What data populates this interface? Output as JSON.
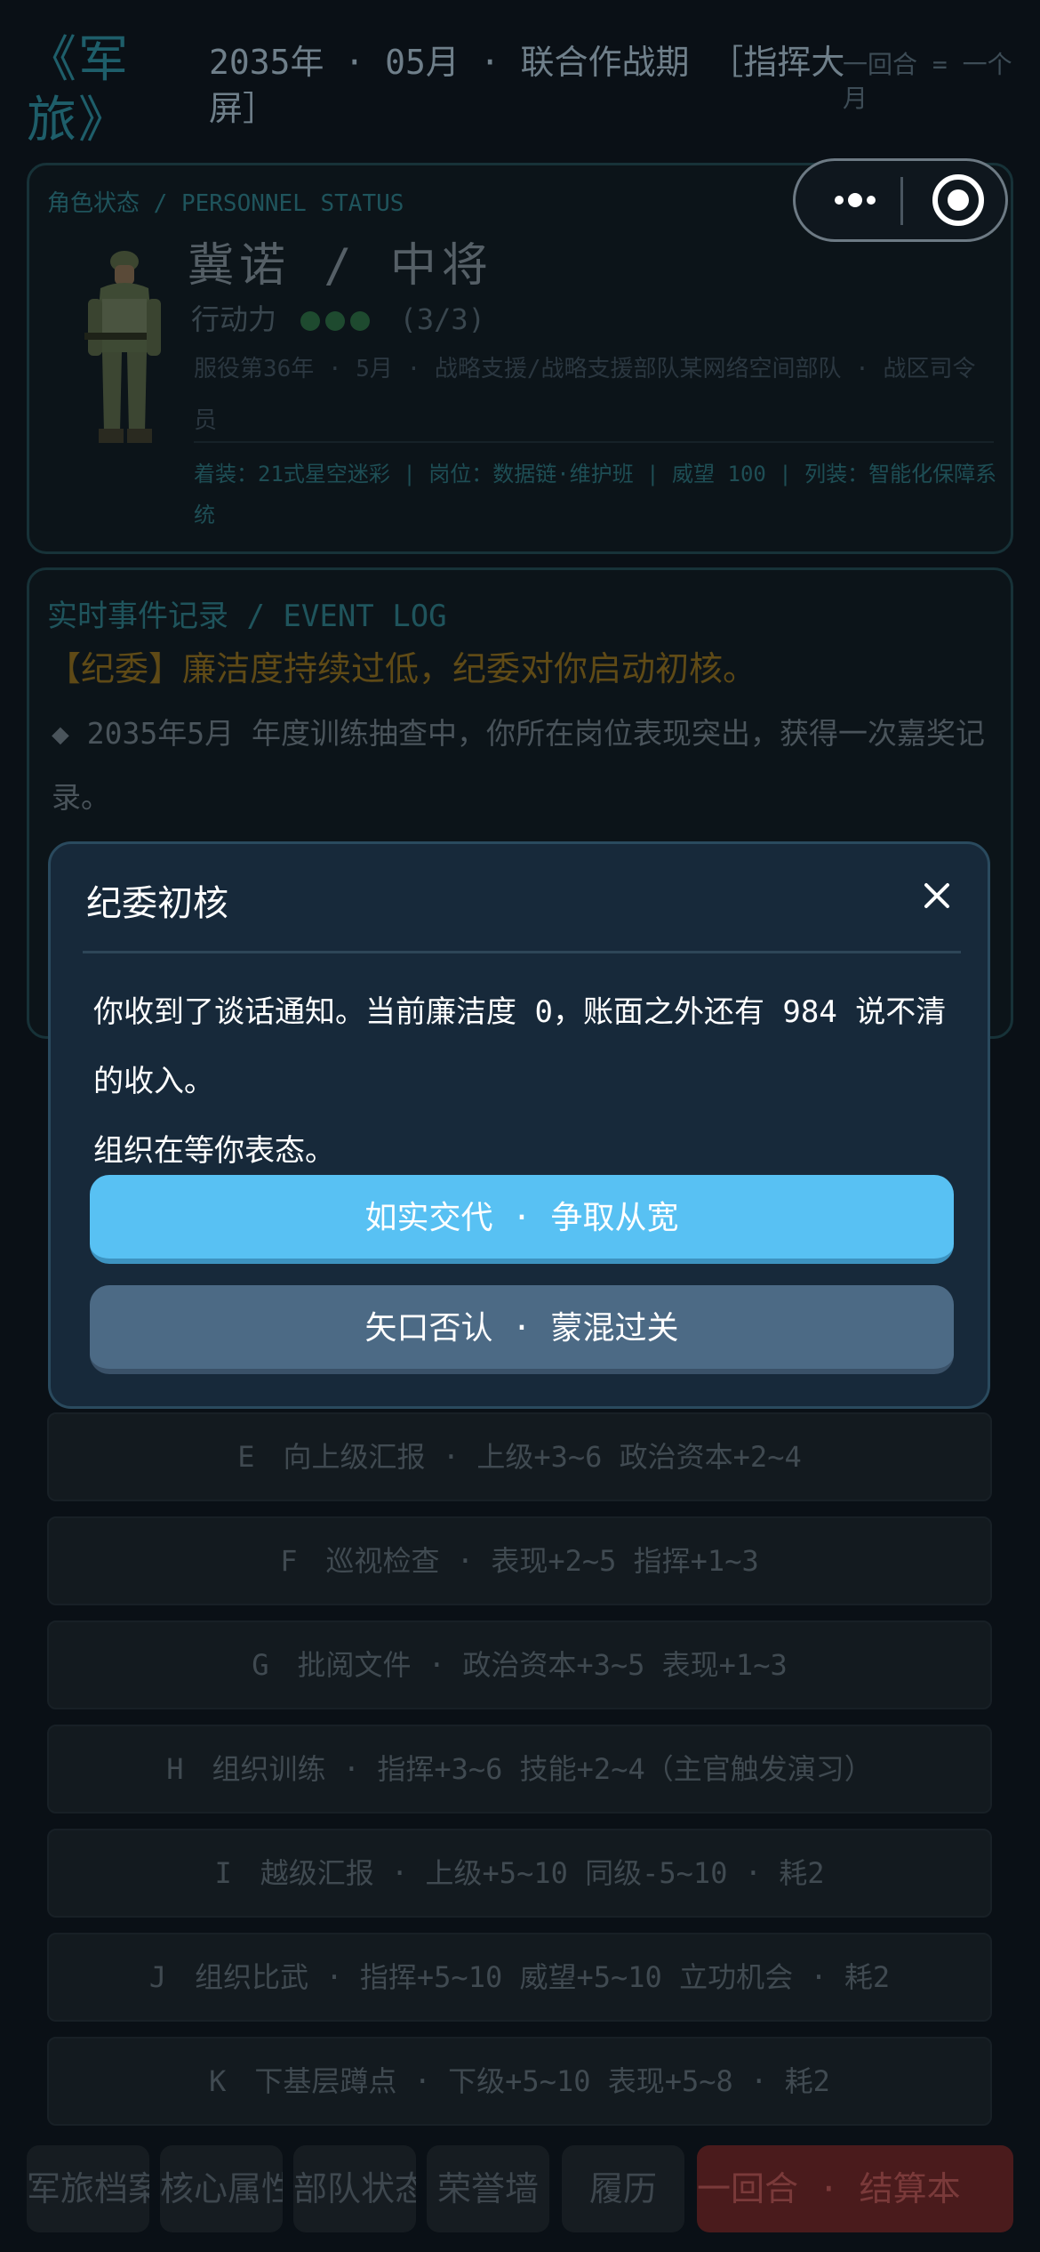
{
  "header": {
    "title": "《军旅》",
    "date_line": "2035年 · 05月 · 联合作战期 ［指挥大屏］",
    "turn_note": "一回合 = 一个月"
  },
  "status_panel": {
    "label": "角色状态 / PERSONNEL STATUS",
    "name_rank": "冀诺 / 中将",
    "action_points_label": "行动力",
    "action_points_dots": 3,
    "action_points_text": "(3/3)",
    "service_line": "服役第36年 · 5月 · 战略支援/战略支援部队某网络空间部队 · 战区司令员",
    "gear_line": "着装：21式星空迷彩 | 岗位：数据链·维护班 | 威望 100 | 列装：智能化保障系统"
  },
  "event_panel": {
    "label": "实时事件记录 / EVENT LOG",
    "alert": "【纪委】廉洁度持续过低，纪委对你启动初核。",
    "entry": "◆ 2035年5月 年度训练抽查中，你所在岗位表现突出，获得一次嘉奖记录。"
  },
  "actions": [
    "E　向上级汇报 · 上级+3~6 政治资本+2~4",
    "F　巡视检查 · 表现+2~5 指挥+1~3",
    "G　批阅文件 · 政治资本+3~5 表现+1~3",
    "H　组织训练 · 指挥+3~6 技能+2~4（主官触发演习）",
    "I　越级汇报 · 上级+5~10 同级-5~10 · 耗2",
    "J　组织比武 · 指挥+5~10 威望+5~10 立功机会 · 耗2",
    "K　下基层蹲点 · 下级+5~10 表现+5~8 · 耗2"
  ],
  "tabs": [
    "军旅档案",
    "核心属性",
    "部队状态",
    "荣誉墙",
    "履历"
  ],
  "end_turn": "一回合 · 结算本",
  "modal": {
    "title": "纪委初核",
    "body_line1": "你收到了谈话通知。当前廉洁度 0，账面之外还有 984 说不清的收入。",
    "body_line2": "组织在等你表态。",
    "primary_button": "如实交代 · 争取从宽",
    "secondary_button": "矢口否认 · 蒙混过关"
  },
  "icons": {
    "close": "close-icon",
    "more": "more-dots-icon",
    "target": "target-icon",
    "soldier": "soldier-avatar"
  },
  "colors": {
    "primary_button": "#58c1f3",
    "secondary_button": "#4c6a85",
    "modal_bg": "#17293a",
    "end_turn": "#4a1b1c"
  }
}
